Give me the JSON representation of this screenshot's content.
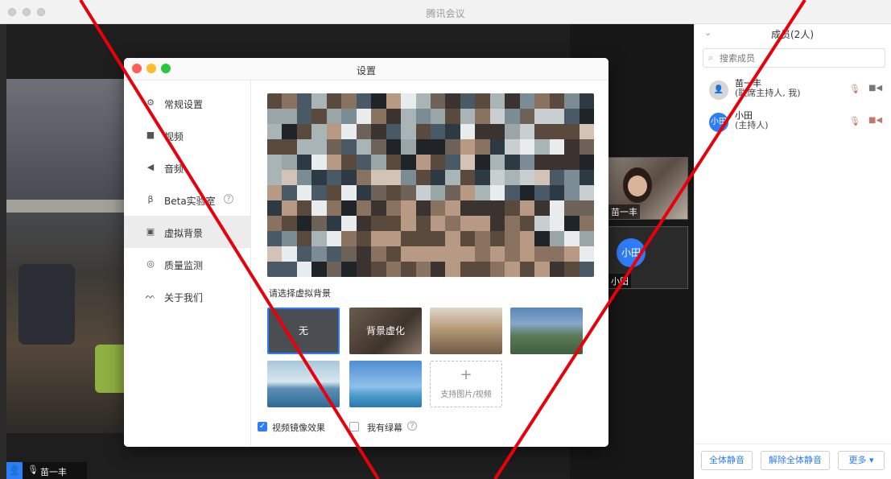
{
  "window": {
    "title": "腾讯会议"
  },
  "participant_thumbs": [
    {
      "label": "苗一丰"
    },
    {
      "label": "小田",
      "avatar_text": "小田"
    }
  ],
  "self_bar": {
    "name": "苗一丰"
  },
  "members": {
    "header": "成员(2人)",
    "search_placeholder": "搜索成员",
    "list": [
      {
        "name": "苗一丰",
        "role": "(联席主持人, 我)"
      },
      {
        "name": "小田",
        "role": "(主持人)",
        "avatar_text": "小田"
      }
    ],
    "buttons": {
      "mute_all": "全体静音",
      "unmute_all": "解除全体静音",
      "more": "更多 ▾"
    }
  },
  "settings": {
    "title": "设置",
    "nav": [
      {
        "label": "常规设置",
        "icon": "gear-icon"
      },
      {
        "label": "视频",
        "icon": "camera-icon"
      },
      {
        "label": "音频",
        "icon": "speaker-icon"
      },
      {
        "label": "Beta实验室",
        "icon": "beta-icon"
      },
      {
        "label": "虚拟背景",
        "icon": "portrait-icon",
        "active": true
      },
      {
        "label": "质量监测",
        "icon": "monitor-icon"
      },
      {
        "label": "关于我们",
        "icon": "about-icon"
      }
    ],
    "choose_label": "请选择虚拟背景",
    "backgrounds": {
      "none": "无",
      "blur": "背景虚化"
    },
    "add_background": {
      "plus": "+",
      "label": "支持图片/视频"
    },
    "mirror_label": "视频镜像效果",
    "mirror_checked": true,
    "greenscreen_label": "我有绿幕",
    "greenscreen_checked": false
  },
  "colors": {
    "accent": "#2f7df6",
    "overlay_cross": "#e8000b"
  }
}
